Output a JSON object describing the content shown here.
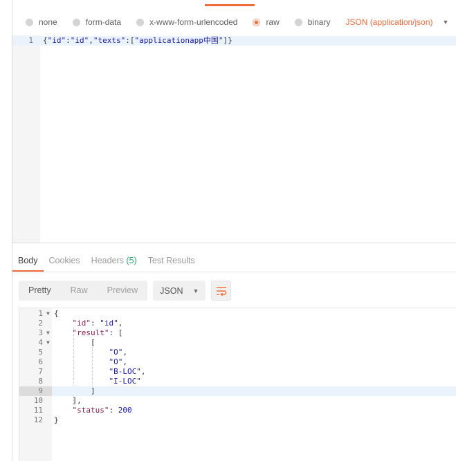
{
  "body_types": {
    "options": [
      "none",
      "form-data",
      "x-www-form-urlencoded",
      "raw",
      "binary"
    ],
    "selected": "raw",
    "content_type": "JSON (application/json)"
  },
  "request_editor": {
    "line_number": "1",
    "text": "{\"id\":\"id\",\"texts\":[\"applicationapp中国\"]}"
  },
  "response_tabs": {
    "body": "Body",
    "cookies": "Cookies",
    "headers": "Headers",
    "headers_count": "(5)",
    "test_results": "Test Results"
  },
  "response_toolbar": {
    "pretty": "Pretty",
    "raw": "Raw",
    "preview": "Preview",
    "format": "JSON"
  },
  "response_lines": [
    "{",
    "    \"id\": \"id\",",
    "    \"result\": [",
    "        [",
    "            \"O\",",
    "            \"O\",",
    "            \"B-LOC\",",
    "            \"I-LOC\"",
    "        ]",
    "    ],",
    "    \"status\": 200",
    "}"
  ],
  "response_line_numbers": [
    "1",
    "2",
    "3",
    "4",
    "5",
    "6",
    "7",
    "8",
    "9",
    "10",
    "11",
    "12"
  ],
  "colors": {
    "accent": "#f26b3a",
    "json_key": "#8b1a4b",
    "json_string": "#1a1aa6",
    "headers_count": "#2aa66a"
  }
}
